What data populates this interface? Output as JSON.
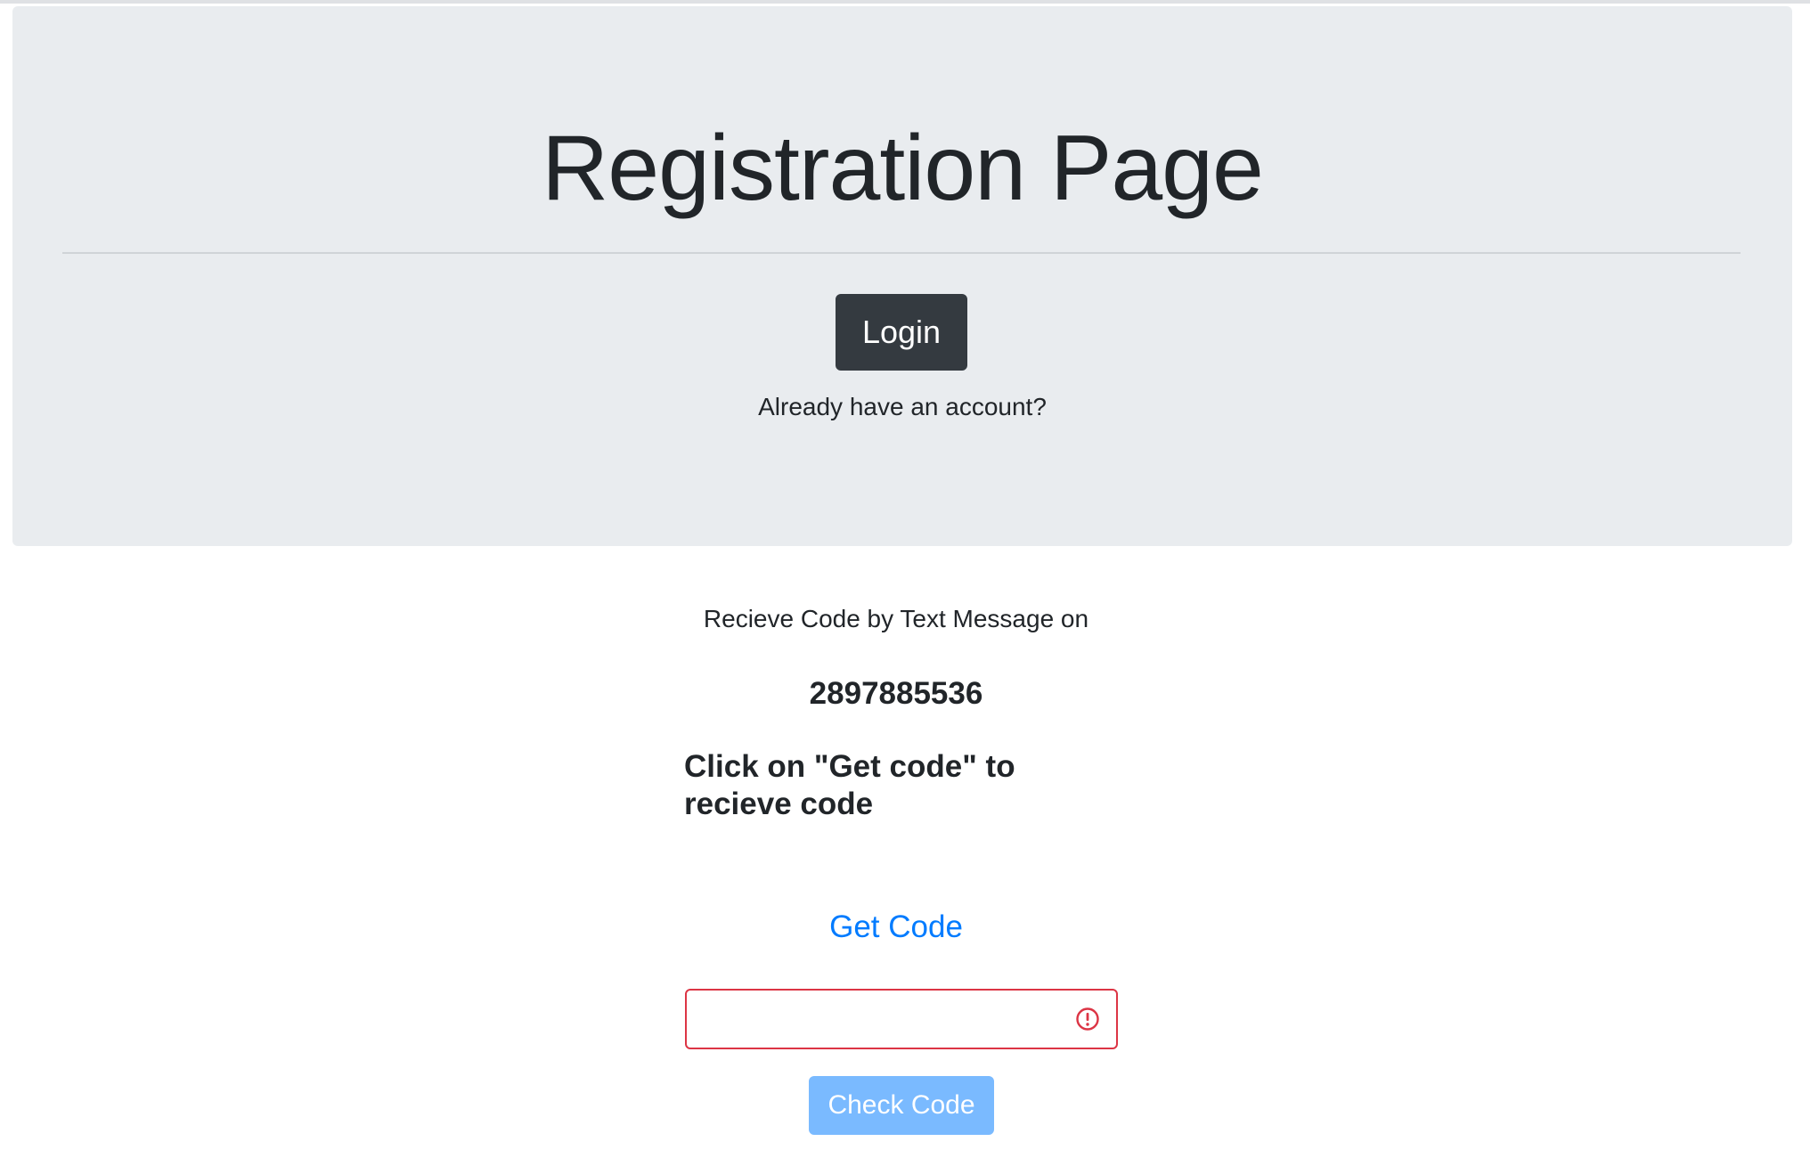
{
  "header": {
    "title": "Registration Page",
    "login_button": "Login",
    "already_text": "Already have an account?"
  },
  "verification": {
    "receive_text": "Recieve Code by Text Message on",
    "phone_number": "2897885536",
    "instructions": "Click on \"Get code\" to recieve code",
    "get_code_label": "Get Code",
    "code_input_value": "",
    "code_input_state": "invalid",
    "check_code_label": "Check Code",
    "check_code_disabled": true
  },
  "colors": {
    "jumbotron_bg": "#e9ecef",
    "dark_button": "#343a40",
    "link_blue": "#007bff",
    "error_red": "#dc3545",
    "disabled_primary": "#7abaff"
  },
  "icons": {
    "input_status": "alert-circle-icon"
  }
}
